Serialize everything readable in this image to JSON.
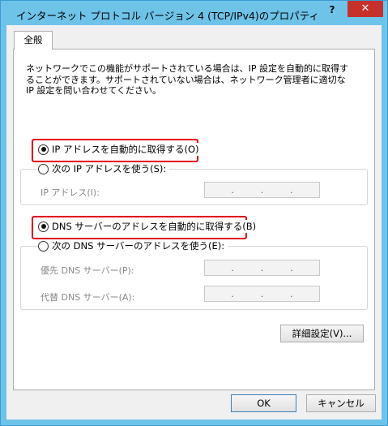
{
  "window": {
    "title": "インターネット プロトコル バージョン 4 (TCP/IPv4)のプロパティ",
    "help_glyph": "?",
    "close_glyph": "✕"
  },
  "tabs": [
    {
      "label": "全般"
    }
  ],
  "description": "ネットワークでこの機能がサポートされている場合は、IP 設定を自動的に取得することができます。サポートされていない場合は、ネットワーク管理者に適切な IP 設定を問い合わせてください。",
  "ip": {
    "auto_label": "IP アドレスを自動的に取得する(O)",
    "manual_label": "次の IP アドレスを使う(S):",
    "address_label": "IP アドレス(I):",
    "selected": "auto"
  },
  "dns": {
    "auto_label": "DNS サーバーのアドレスを自動的に取得する(B)",
    "manual_label": "次の DNS サーバーのアドレスを使う(E):",
    "preferred_label": "優先 DNS サーバー(P):",
    "alternate_label": "代替 DNS サーバー(A):",
    "selected": "auto"
  },
  "ip_field": {
    "dot": "."
  },
  "buttons": {
    "advanced": "詳細設定(V)...",
    "ok": "OK",
    "cancel": "キャンセル"
  },
  "colors": {
    "title_bar": "#6ec3e9",
    "close_button": "#c7302b",
    "highlight": "#e0001b"
  }
}
